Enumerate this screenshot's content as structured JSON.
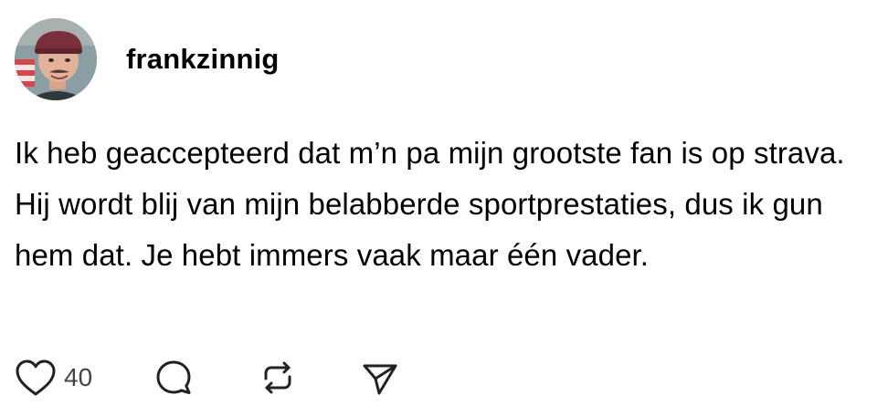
{
  "author": {
    "username": "frankzinnig",
    "avatar": "profile-photo"
  },
  "post": {
    "text": "Ik heb geaccepteerd dat m’n pa mijn grootste fan is op strava. Hij wordt blij van mijn belabberde sportprestaties, dus ik gun hem dat. Je hebt immers vaak maar één vader."
  },
  "actions": {
    "like_count": "40",
    "icons": [
      "heart-icon",
      "comment-icon",
      "repost-icon",
      "send-icon"
    ]
  },
  "colors": {
    "text": "#000000",
    "icon": "#222222",
    "count": "#444444",
    "background": "#ffffff"
  }
}
